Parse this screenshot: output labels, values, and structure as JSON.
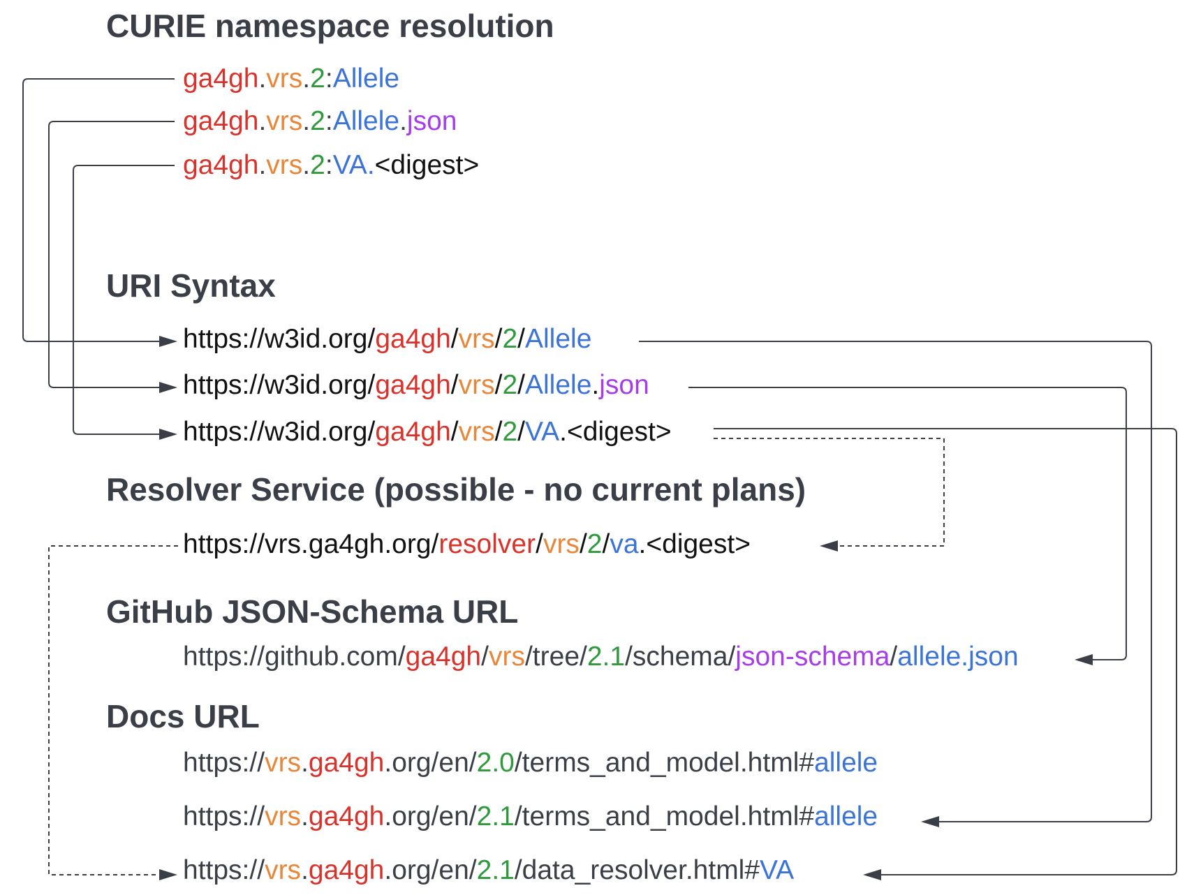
{
  "headings": {
    "curie": "CURIE namespace resolution",
    "uri": "URI Syntax",
    "resolver": "Resolver Service (possible - no current plans)",
    "github": "GitHub JSON-Schema URL",
    "docs": "Docs URL"
  },
  "colors": {
    "red": "#d9322b",
    "orange": "#e8873a",
    "green": "#2e9a3c",
    "blue": "#3b74d6",
    "purple": "#a63de8",
    "black": "#111111",
    "gray": "#3a3f47",
    "connector": "#3a3f47"
  },
  "curie_lines": [
    [
      [
        "ga4gh",
        "red"
      ],
      [
        ".",
        "gray"
      ],
      [
        "vrs",
        "orange"
      ],
      [
        ".",
        "gray"
      ],
      [
        "2",
        "green"
      ],
      [
        ":",
        "gray"
      ],
      [
        "Allele",
        "blue"
      ]
    ],
    [
      [
        "ga4gh",
        "red"
      ],
      [
        ".",
        "gray"
      ],
      [
        "vrs",
        "orange"
      ],
      [
        ".",
        "gray"
      ],
      [
        "2",
        "green"
      ],
      [
        ":",
        "gray"
      ],
      [
        "Allele",
        "blue"
      ],
      [
        ".",
        "gray"
      ],
      [
        "json",
        "purple"
      ]
    ],
    [
      [
        "ga4gh",
        "red"
      ],
      [
        ".",
        "gray"
      ],
      [
        "vrs",
        "orange"
      ],
      [
        ".",
        "gray"
      ],
      [
        "2",
        "green"
      ],
      [
        ":",
        "gray"
      ],
      [
        "VA.",
        "blue"
      ],
      [
        "<digest>",
        "black"
      ]
    ]
  ],
  "uri_lines": [
    [
      [
        "https://w3id.org/",
        "black"
      ],
      [
        "ga4gh",
        "red"
      ],
      [
        "/",
        "black"
      ],
      [
        "vrs",
        "orange"
      ],
      [
        "/",
        "black"
      ],
      [
        "2",
        "green"
      ],
      [
        "/",
        "black"
      ],
      [
        "Allele",
        "blue"
      ]
    ],
    [
      [
        "https://w3id.org/",
        "black"
      ],
      [
        "ga4gh",
        "red"
      ],
      [
        "/",
        "black"
      ],
      [
        "vrs",
        "orange"
      ],
      [
        "/",
        "black"
      ],
      [
        "2",
        "green"
      ],
      [
        "/",
        "black"
      ],
      [
        "Allele",
        "blue"
      ],
      [
        ".",
        "black"
      ],
      [
        "json",
        "purple"
      ]
    ],
    [
      [
        "https://w3id.org/",
        "black"
      ],
      [
        "ga4gh",
        "red"
      ],
      [
        "/",
        "black"
      ],
      [
        "vrs",
        "orange"
      ],
      [
        "/",
        "black"
      ],
      [
        "2",
        "green"
      ],
      [
        "/",
        "black"
      ],
      [
        "VA",
        "blue"
      ],
      [
        ".<digest>",
        "black"
      ]
    ]
  ],
  "resolver_lines": [
    [
      [
        "https://vrs.ga4gh.org/",
        "black"
      ],
      [
        "resolver",
        "red"
      ],
      [
        "/",
        "black"
      ],
      [
        "vrs",
        "orange"
      ],
      [
        "/",
        "black"
      ],
      [
        "2",
        "green"
      ],
      [
        "/",
        "black"
      ],
      [
        "va",
        "blue"
      ],
      [
        ".<digest>",
        "black"
      ]
    ]
  ],
  "github_lines": [
    [
      [
        "https://github.com/",
        "gray"
      ],
      [
        "ga4gh",
        "red"
      ],
      [
        "/",
        "gray"
      ],
      [
        "vrs",
        "orange"
      ],
      [
        "/tree/",
        "gray"
      ],
      [
        "2.1",
        "green"
      ],
      [
        "/schema/",
        "gray"
      ],
      [
        "json-schema",
        "purple"
      ],
      [
        "/",
        "gray"
      ],
      [
        "allele.json",
        "blue"
      ]
    ]
  ],
  "docs_lines": [
    [
      [
        "https://",
        "gray"
      ],
      [
        "vrs",
        "orange"
      ],
      [
        ".",
        "gray"
      ],
      [
        "ga4gh",
        "red"
      ],
      [
        ".org/en/",
        "gray"
      ],
      [
        "2.0",
        "green"
      ],
      [
        "/terms_and_model.html#",
        "gray"
      ],
      [
        "allele",
        "blue"
      ]
    ],
    [
      [
        "https://",
        "gray"
      ],
      [
        "vrs",
        "orange"
      ],
      [
        ".",
        "gray"
      ],
      [
        "ga4gh",
        "red"
      ],
      [
        ".org/en/",
        "gray"
      ],
      [
        "2.1",
        "green"
      ],
      [
        "/terms_and_model.html#",
        "gray"
      ],
      [
        "allele",
        "blue"
      ]
    ],
    [
      [
        "https://",
        "gray"
      ],
      [
        "vrs",
        "orange"
      ],
      [
        ".",
        "gray"
      ],
      [
        "ga4gh",
        "red"
      ],
      [
        ".org/en/",
        "gray"
      ],
      [
        "2.1",
        "green"
      ],
      [
        "/data_resolver.html#",
        "gray"
      ],
      [
        "VA",
        "blue"
      ]
    ]
  ]
}
